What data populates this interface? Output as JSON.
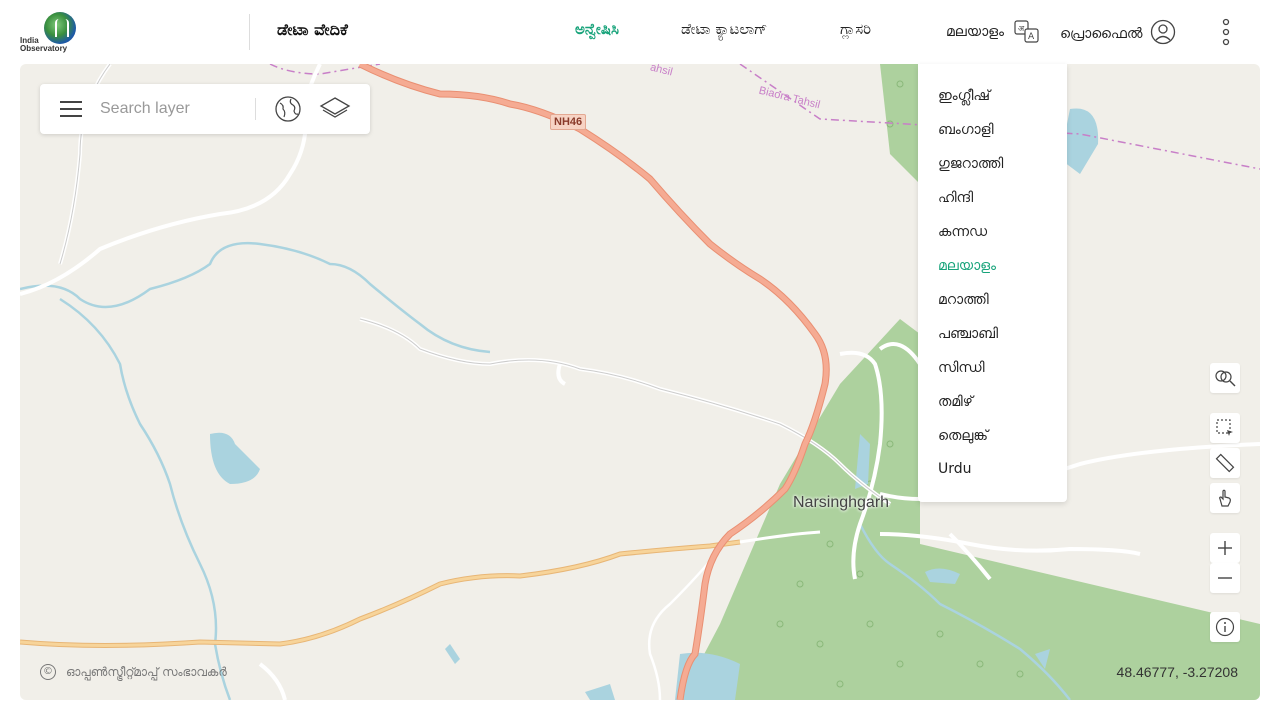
{
  "header": {
    "logo_text": "India Observatory",
    "app_title": "ಡೇಟಾ ವೇದಿಕೆ",
    "nav": [
      {
        "label": "ಅನ್ವೇಷಿಸಿ",
        "active": true
      },
      {
        "label": "ಡೇಟಾ ಕ್ಯಾಟಲಾಗ್",
        "active": false
      },
      {
        "label": "ಗ್ಲಾಸರಿ",
        "active": false
      }
    ],
    "language_label": "മലയാളം",
    "profile_label": "പ്രൊഫൈൽ"
  },
  "search": {
    "placeholder": "Search layer"
  },
  "language_menu": {
    "options": [
      "ഇംഗ്ലീഷ്",
      "ബംഗാളി",
      "ഗുജറാത്തി",
      "ഹിന്ദി",
      "കന്നഡ",
      "മലയാളം",
      "മറാത്തി",
      "പഞ്ചാബി",
      "സിന്ധി",
      "തമിഴ്",
      "തെലുങ്ക്",
      "Urdu"
    ],
    "selected": "മലയാളം"
  },
  "map": {
    "town_label": "Narsinghgarh",
    "highway_label": "NH46",
    "tahsil_label": "Biaora Tahsil",
    "tahsil_label_partial": "ahsil",
    "attribution": "ഓപ്പൺസ്ട്രീറ്റ്മാപ്പ് സംഭാവകർ",
    "attribution_symbol": "©",
    "coordinates": "48.46777, -3.27208"
  },
  "colors": {
    "accent": "#17a37a",
    "map_background": "#f1efe9",
    "forest": "#add19e",
    "water": "#aad3df",
    "highway": "#f2a48a",
    "secondary_road": "#f7c98a",
    "boundary": "#c87fc8"
  },
  "icons": {
    "language": "translate-icon",
    "profile": "user-icon",
    "menu": "kebab-menu-icon",
    "hamburger": "hamburger-icon",
    "globe": "globe-icon",
    "layers": "layers-icon",
    "search_zoom": "zoom-search-icon",
    "select": "box-select-icon",
    "measure": "ruler-icon",
    "pointer": "hand-pointer-icon",
    "zoom_in": "plus-icon",
    "zoom_out": "minus-icon",
    "info": "info-icon"
  }
}
